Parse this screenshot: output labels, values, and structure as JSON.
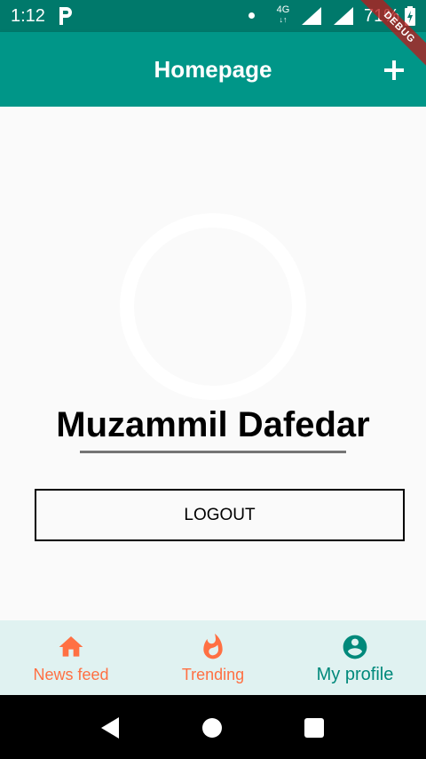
{
  "status_bar": {
    "time": "1:12",
    "network_type": "4G",
    "network_arrows": "↓↑",
    "battery_percent": "71%",
    "icons": [
      "p-icon",
      "notification-dot-icon",
      "signal-icon",
      "signal-icon",
      "battery-charging-icon"
    ]
  },
  "debug_banner": {
    "label": "DEBUG"
  },
  "app_bar": {
    "title": "Homepage",
    "action_icon": "add-icon"
  },
  "profile": {
    "name": "Muzammil Dafedar",
    "avatar_icon": "avatar-ring-icon"
  },
  "logout": {
    "label": "LOGOUT"
  },
  "bottom_nav": {
    "items": [
      {
        "label": "News feed",
        "icon": "home-icon",
        "active": false
      },
      {
        "label": "Trending",
        "icon": "fire-icon",
        "active": false
      },
      {
        "label": "My profile",
        "icon": "account-circle-icon",
        "active": true
      }
    ]
  },
  "system_nav": {
    "icons": [
      "back-icon",
      "home-circle-icon",
      "recents-icon"
    ]
  },
  "colors": {
    "status_bar": "#00796b",
    "app_bar": "#009688",
    "background": "#fafafa",
    "bottom_nav_bg": "#e0f2f1",
    "inactive_nav": "#ff7043",
    "active_nav": "#00897b",
    "underline": "#757575"
  }
}
